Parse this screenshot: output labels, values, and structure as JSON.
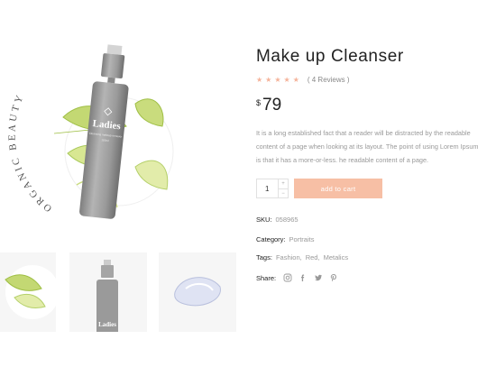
{
  "product": {
    "title": "Make up Cleanser",
    "rating_stars": 5,
    "reviews": "( 4 Reviews )",
    "price_currency": "$",
    "price": "79",
    "description_lines": [
      "It is a long established fact that a reader will be distracted by the readable",
      "content of a page when looking at its layout. The point of using Lorem Ipsum",
      "is that it has a more-or-less. he readable content of a page."
    ],
    "quantity": "1",
    "qty_up": "+",
    "qty_down": "−",
    "add_to_cart": "add to cart",
    "sku_label": "SKU:",
    "sku_value": "058965",
    "category_label": "Category:",
    "category_value": "Portraits",
    "tags_label": "Tags:",
    "tags": [
      "Fashion",
      "Red",
      "Metalics"
    ],
    "tag_separator": ",",
    "share_label": "Share:",
    "share_icons": [
      "instagram-icon",
      "facebook-icon",
      "twitter-icon",
      "pinterest-icon"
    ]
  },
  "image": {
    "arc_text": "ORGANIC BEAUTY",
    "bottle_brand": "Ladies",
    "bottle_sub1": "Cleansing makeup remover",
    "bottle_sub2": "150ml"
  },
  "colors": {
    "accent": "#f7bfa5",
    "stars": "#f5b39a",
    "leaf_dark": "#a8c95a",
    "leaf_light": "#d6e48d",
    "bottle": "#9a9a9a"
  }
}
